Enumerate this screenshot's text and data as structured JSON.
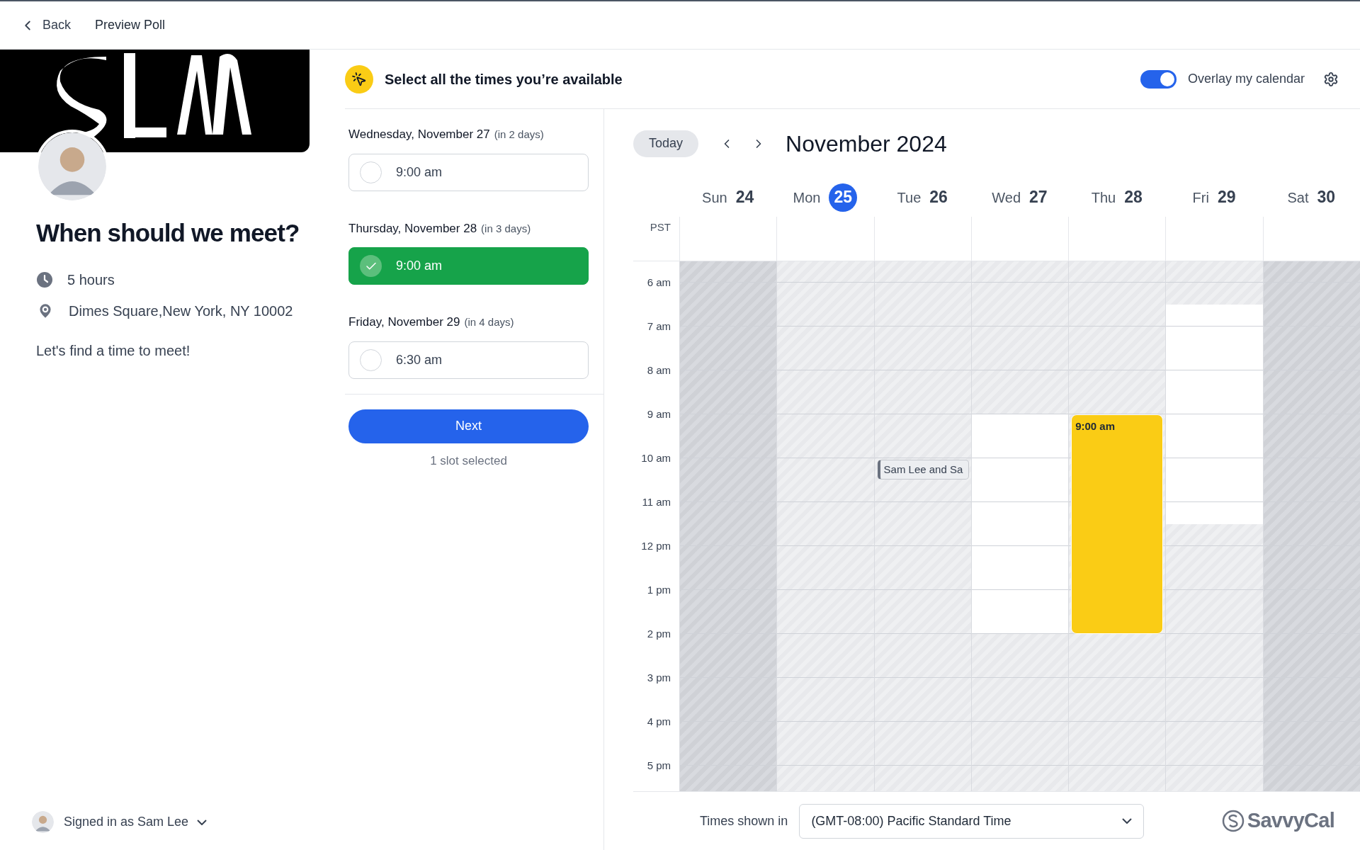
{
  "top_bar": {
    "back": "Back",
    "title": "Preview Poll"
  },
  "profile": {
    "title": "When should we meet?",
    "details": [
      {
        "kind": "duration",
        "text": "5 hours"
      },
      {
        "kind": "location",
        "text": "Dimes Square,New York, NY 10002"
      }
    ],
    "description": "Let's find a time to meet!"
  },
  "account": {
    "label": "Signed in as Sam Lee"
  },
  "prompt": "Select all the times you’re available",
  "overlay": {
    "label": "Overlay my calendar",
    "on": true
  },
  "poll_days": [
    {
      "date": "Wednesday, November 27",
      "relative": "(in 2 days)",
      "slots": [
        {
          "time": "9:00 am",
          "selected": false
        }
      ]
    },
    {
      "date": "Thursday, November 28",
      "relative": "(in 3 days)",
      "slots": [
        {
          "time": "9:00 am",
          "selected": true
        }
      ]
    },
    {
      "date": "Friday, November 29",
      "relative": "(in 4 days)",
      "slots": [
        {
          "time": "6:30 am",
          "selected": false
        }
      ]
    }
  ],
  "next_button": "Next",
  "selection_count": "1 slot selected",
  "calendar": {
    "today_button": "Today",
    "month": "November 2024",
    "timezone": "PST",
    "days": [
      {
        "weekday": "Sun",
        "day": "24",
        "today": false,
        "weekend": true
      },
      {
        "weekday": "Mon",
        "day": "25",
        "today": true,
        "weekend": false
      },
      {
        "weekday": "Tue",
        "day": "26",
        "today": false,
        "weekend": false,
        "event": {
          "title": "Sam Lee and Sa"
        }
      },
      {
        "weekday": "Wed",
        "day": "27",
        "today": false,
        "weekend": false,
        "slot": {
          "selected": false
        }
      },
      {
        "weekday": "Thu",
        "day": "28",
        "today": false,
        "weekend": false,
        "slot": {
          "selected": true,
          "label": "9:00 am"
        }
      },
      {
        "weekday": "Fri",
        "day": "29",
        "today": false,
        "weekend": false,
        "slot": {
          "selected": false
        }
      },
      {
        "weekday": "Sat",
        "day": "30",
        "today": false,
        "weekend": true
      }
    ],
    "hours": [
      "6 am",
      "7 am",
      "8 am",
      "9 am",
      "10 am",
      "11 am",
      "12 pm",
      "1 pm",
      "2 pm",
      "3 pm",
      "4 pm",
      "5 pm"
    ]
  },
  "footer": {
    "label": "Times shown in",
    "timezone_select": "(GMT-08:00) Pacific Standard Time",
    "brand": "SavvyCal"
  }
}
